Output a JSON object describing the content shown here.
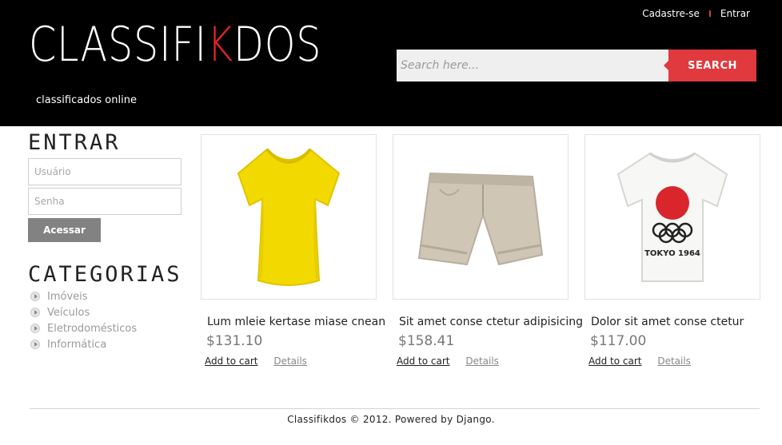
{
  "header": {
    "links": {
      "signup": "Cadastre-se",
      "login": "Entrar"
    },
    "logo": {
      "prefix": "CLASSIFI",
      "highlight": "K",
      "suffix": "DOS",
      "tagline": "classificados online"
    },
    "search": {
      "placeholder": "Search here...",
      "button": "SEARCH"
    },
    "colors": {
      "background": "#000000",
      "accent": "#e03a3e"
    }
  },
  "sidebar": {
    "login": {
      "title": "ENTRAR",
      "username_placeholder": "Usuário",
      "password_placeholder": "Senha",
      "button": "Acessar"
    },
    "categories": {
      "title": "CATEGORIAS",
      "items": [
        "Imóveis",
        "Veículos",
        "Eletrodomésticos",
        "Informática"
      ]
    }
  },
  "products": [
    {
      "name": "Lum mleie kertase miase cnean",
      "price": "$131.10",
      "add_to_cart": "Add to cart",
      "details": "Details",
      "image": "yellow-tshirt-icon"
    },
    {
      "name": "Sit amet conse ctetur adipisicing",
      "price": "$158.41",
      "add_to_cart": "Add to cart",
      "details": "Details",
      "image": "khaki-shorts-icon"
    },
    {
      "name": "Dolor sit amet conse ctetur",
      "price": "$117.00",
      "add_to_cart": "Add to cart",
      "details": "Details",
      "image": "tokyo-1964-tshirt-icon",
      "print_text": "TOKYO 1964"
    }
  ],
  "footer": {
    "text": "Classifikdos © 2012. Powered by Django."
  }
}
